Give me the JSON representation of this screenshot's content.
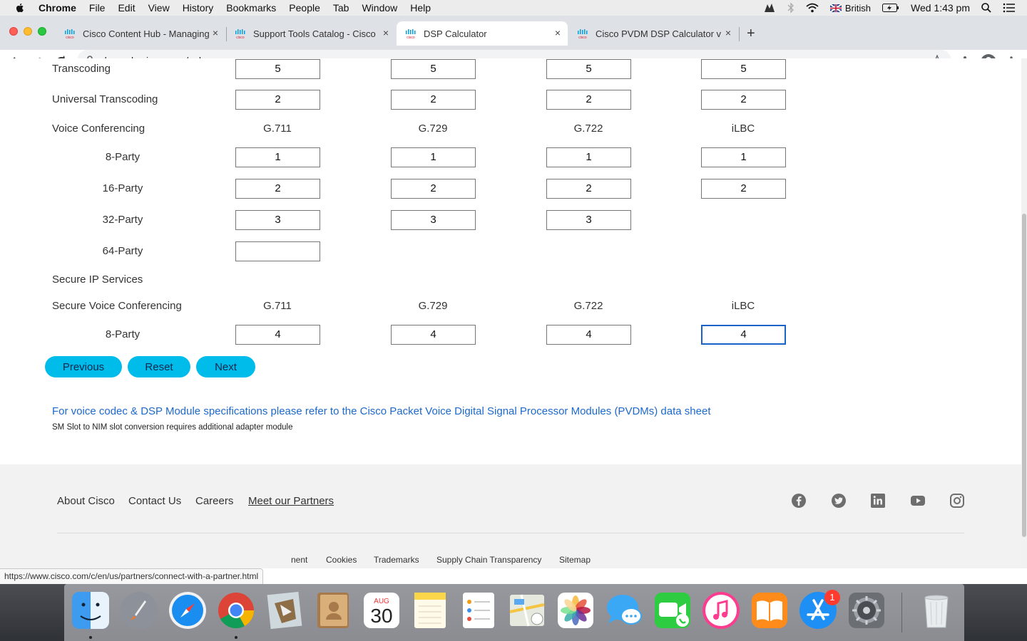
{
  "menubar": {
    "app": "Chrome",
    "items": [
      "File",
      "Edit",
      "View",
      "History",
      "Bookmarks",
      "People",
      "Tab",
      "Window",
      "Help"
    ],
    "input_source": "British",
    "clock": "Wed 1:43 pm"
  },
  "tabs": [
    {
      "label": "Cisco Content Hub - Managing",
      "close": "×"
    },
    {
      "label": "Support Tools Catalog - Cisco",
      "close": "×"
    },
    {
      "label": "DSP Calculator",
      "close": "×"
    },
    {
      "label": "Cisco PVDM DSP Calculator v",
      "close": "×"
    }
  ],
  "newtab": "+",
  "url": "dsp-calc.cisco.com/calc",
  "calc": {
    "transcoding": {
      "label": "Transcoding",
      "values": [
        "5",
        "5",
        "5",
        "5"
      ]
    },
    "universal_transcoding": {
      "label": "Universal Transcoding",
      "values": [
        "2",
        "2",
        "2",
        "2"
      ]
    },
    "voice_conf": {
      "label": "Voice Conferencing",
      "codecs": [
        "G.711",
        "G.729",
        "G.722",
        "iLBC"
      ],
      "party8": {
        "label": "8-Party",
        "values": [
          "1",
          "1",
          "1",
          "1"
        ]
      },
      "party16": {
        "label": "16-Party",
        "values": [
          "2",
          "2",
          "2",
          "2"
        ]
      },
      "party32": {
        "label": "32-Party",
        "values": [
          "3",
          "3",
          "3"
        ]
      },
      "party64": {
        "label": "64-Party",
        "values": [
          ""
        ]
      }
    },
    "secure_ip": {
      "label": "Secure IP Services"
    },
    "secure_voice_conf": {
      "label": "Secure Voice Conferencing",
      "codecs": [
        "G.711",
        "G.729",
        "G.722",
        "iLBC"
      ],
      "party8": {
        "label": "8-Party",
        "values": [
          "4",
          "4",
          "4",
          "4"
        ]
      }
    }
  },
  "buttons": {
    "previous": "Previous",
    "reset": "Reset",
    "next": "Next"
  },
  "info_link": "For voice codec & DSP Module specifications please refer to the Cisco Packet Voice Digital Signal Processor Modules (PVDMs) data sheet",
  "note": "SM Slot to NIM slot conversion requires additional adapter module",
  "footer": {
    "links": [
      "About Cisco",
      "Contact Us",
      "Careers",
      "Meet our Partners"
    ],
    "small_links": [
      "nent",
      "Cookies",
      "Trademarks",
      "Supply Chain Transparency",
      "Sitemap"
    ],
    "social": [
      "facebook-icon",
      "twitter-icon",
      "linkedin-icon",
      "youtube-icon",
      "instagram-icon"
    ]
  },
  "status_url": "https://www.cisco.com/c/en/us/partners/connect-with-a-partner.html",
  "dock": {
    "calendar_month": "AUG",
    "calendar_day": "30",
    "appstore_badge": "1"
  },
  "colors": {
    "accent": "#00bceb",
    "link": "#1d69cc",
    "focus": "#1a62c8"
  }
}
